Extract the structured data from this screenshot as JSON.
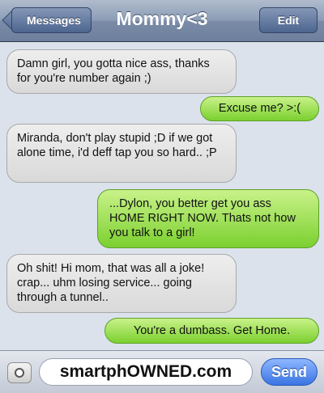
{
  "header": {
    "back_label": "Messages",
    "title": "Mommy<3",
    "edit_label": "Edit"
  },
  "messages": [
    {
      "from": "received",
      "text": "Damn girl, you gotta nice ass, thanks for you're number again ;)"
    },
    {
      "from": "sent",
      "text": "Excuse me? >:("
    },
    {
      "from": "received",
      "text": "Miranda, don't play stupid ;D if we got alone time, i'd deff tap you so hard.. ;P"
    },
    {
      "from": "sent",
      "text": "...Dylon, you better get you ass HOME RIGHT NOW. Thats not how you talk to a girl!"
    },
    {
      "from": "received",
      "text": "Oh shit! Hi mom, that was all a joke! crap... uhm losing service... going through a tunnel.."
    },
    {
      "from": "sent",
      "text": "You're a dumbass. Get Home."
    }
  ],
  "input_bar": {
    "field_text": "smartphOWNED.com",
    "send_label": "Send"
  },
  "colors": {
    "sent_bubble": "#7bd02f",
    "received_bubble": "#d9d9d9",
    "navbar": "#7b8ca8",
    "send_button": "#3b74e3"
  }
}
